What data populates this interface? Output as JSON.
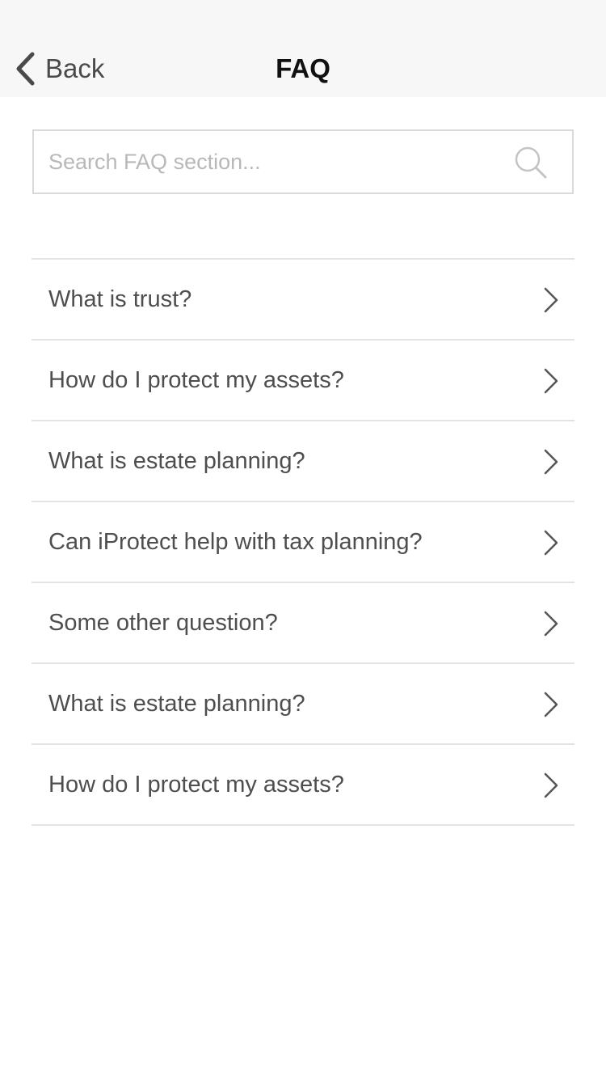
{
  "nav": {
    "back_label": "Back",
    "title": "FAQ"
  },
  "search": {
    "placeholder": "Search FAQ section...",
    "value": "",
    "icon": "search-icon"
  },
  "faq": {
    "items": [
      {
        "question": "What is trust?",
        "icon": "chevron-right-icon"
      },
      {
        "question": "How do I protect my assets?",
        "icon": "chevron-right-icon"
      },
      {
        "question": "What is estate planning?",
        "icon": "chevron-right-icon"
      },
      {
        "question": "Can iProtect help with tax planning?",
        "icon": "chevron-right-icon"
      },
      {
        "question": "Some other question?",
        "icon": "chevron-right-icon"
      },
      {
        "question": "What is estate planning?",
        "icon": "chevron-right-icon"
      },
      {
        "question": "How do I protect my assets?",
        "icon": "chevron-right-icon"
      }
    ]
  },
  "colors": {
    "nav_background": "#f7f7f7",
    "text_primary": "#4e4e4e",
    "title_text": "#111111",
    "divider": "#e3e3e3",
    "placeholder": "#b8b8b8"
  }
}
